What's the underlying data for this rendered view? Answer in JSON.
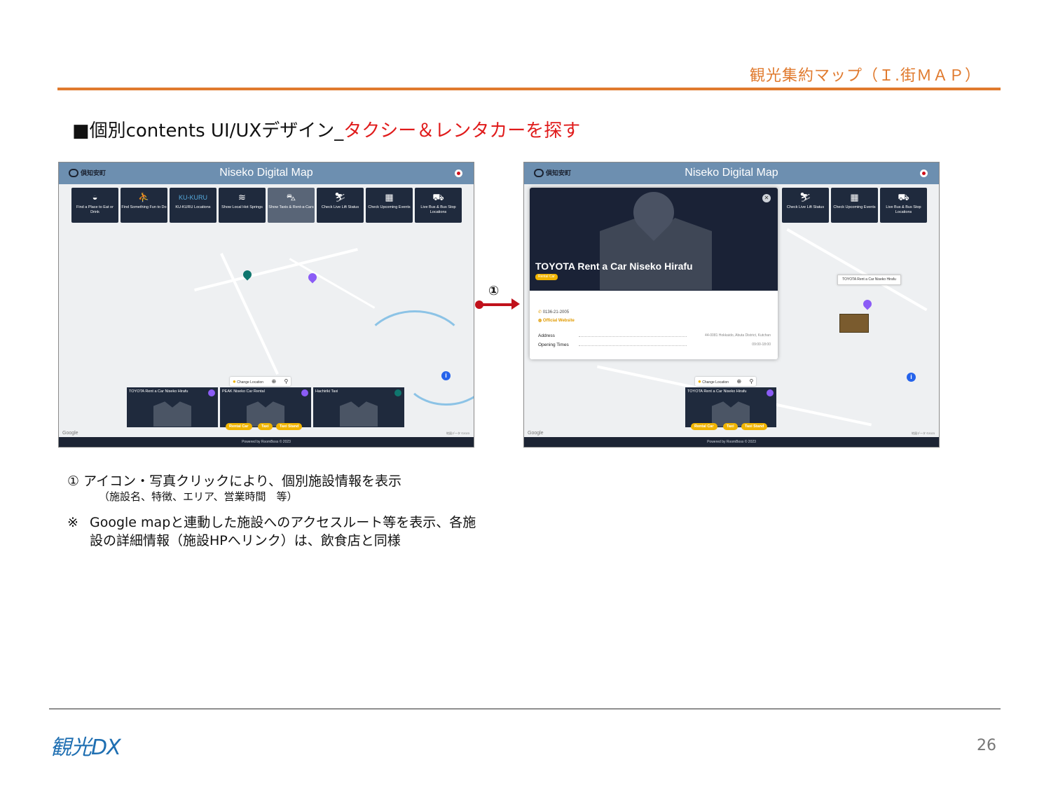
{
  "header": {
    "title": "観光集約マップ（Ｉ.街ＭＡＰ）"
  },
  "heading": {
    "prefix": "■個別contents UI/UXデザイン_",
    "accent": "タクシー＆レンタカーを探す"
  },
  "app": {
    "logo_text": "倶知安町",
    "title": "Niseko Digital Map",
    "footer": "Powered by RoomBoss © 2023",
    "google": "Google",
    "map_credit": "地図データ ©2023",
    "change_location": "Change Location",
    "categories": [
      {
        "icon": "restaurant-icon",
        "label": "Find a Place to Eat or Drink"
      },
      {
        "icon": "hiker-icon",
        "label": "Find Something Fun to Do"
      },
      {
        "icon": "ku-kuru-logo",
        "label": "KU-KURU Locations"
      },
      {
        "icon": "hot-spring-icon",
        "label": "Show Local Hot Springs"
      },
      {
        "icon": "car-icon",
        "label": "Show Taxis & Rent-a-Cars"
      },
      {
        "icon": "skier-icon",
        "label": "Check Live Lift Status"
      },
      {
        "icon": "calendar-icon",
        "label": "Check Upcoming Events"
      },
      {
        "icon": "bus-icon",
        "label": "Live Bus & Bus Stop Locations"
      }
    ],
    "result_cards": [
      {
        "name": "TOYOTA Rent a Car Niseko Hirafu"
      },
      {
        "name": "PEAK Niseko Car Rental"
      },
      {
        "name": "Hachiriki Taxi"
      }
    ],
    "filters": [
      "Rental Car",
      "Taxi",
      "Taxi Stand"
    ],
    "accent_color": "#f0b400",
    "bar_color": "#6d8fb0"
  },
  "detail": {
    "name": "TOYOTA Rent a Car Niseko Hirafu",
    "badge": "Rental Car",
    "phone": "0136-21-2005",
    "website": "Official Website",
    "address_label": "Address",
    "address_value": "44-0081 Hokkaido, Abuta District, Kutchan",
    "hours_label": "Opening Times",
    "hours_value": "09:00-18:00",
    "tooltip": "TOYOTA Rent a Car Niseko Hirafu"
  },
  "step": {
    "number": "①"
  },
  "notes": {
    "n1": "①  アイコン・写真クリックにより、個別施設情報を表示",
    "n1_sub": "（施設名、特徴、エリア、営業時間　等）",
    "n2_mark": "※",
    "n2": "Google mapと連動した施設へのアクセスルート等を表示、各施設の詳細情報（施設HPへリンク）は、飲食店と同様"
  },
  "footer": {
    "logo": "観光DX",
    "page": "26"
  }
}
